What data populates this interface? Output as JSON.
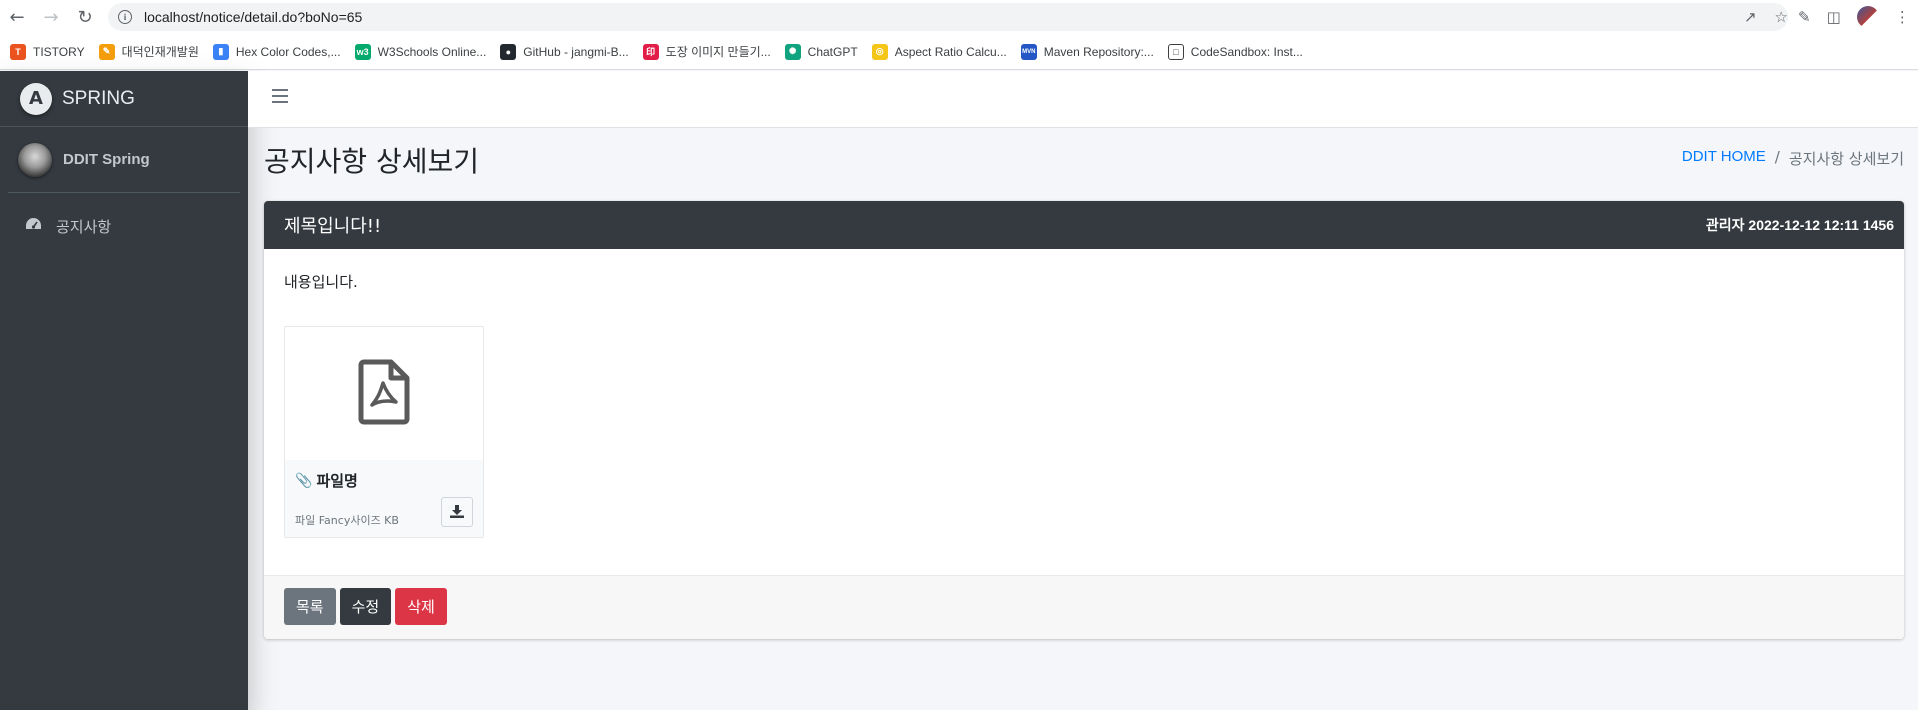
{
  "browser": {
    "url": "localhost/notice/detail.do?boNo=65",
    "bookmarks": [
      {
        "label": "TISTORY",
        "color": "#eb531f",
        "icon": "T"
      },
      {
        "label": "대덕인재개발원",
        "color": "#f59e0b",
        "icon": "✎"
      },
      {
        "label": "Hex Color Codes,...",
        "color": "#3b82f6",
        "icon": "▮"
      },
      {
        "label": "W3Schools Online...",
        "color": "#04aa6d",
        "icon": "w3"
      },
      {
        "label": "GitHub - jangmi-B...",
        "color": "#24292f",
        "icon": "●"
      },
      {
        "label": "도장 이미지 만들기...",
        "color": "#e11d48",
        "icon": "印"
      },
      {
        "label": "ChatGPT",
        "color": "#10a37f",
        "icon": "✺"
      },
      {
        "label": "Aspect Ratio Calcu...",
        "color": "#f5c518",
        "icon": "◎"
      },
      {
        "label": "Maven Repository:...",
        "color": "#2457c5",
        "icon": "MVN"
      },
      {
        "label": "CodeSandbox: Inst...",
        "color": "#ffffff",
        "icon": "□"
      }
    ]
  },
  "sidebar": {
    "brand": "SPRING",
    "brand_logo": "A",
    "user": "DDIT Spring",
    "items": [
      {
        "label": "공지사항",
        "icon": "tachometer-icon"
      }
    ]
  },
  "page": {
    "title": "공지사항 상세보기",
    "breadcrumb": {
      "home": "DDIT HOME",
      "current": "공지사항 상세보기"
    }
  },
  "notice": {
    "title": "제목입니다!!",
    "meta": "관리자 2022-12-12 12:11 1456",
    "content": "내용입니다.",
    "attachment": {
      "name": "파일명",
      "size": "파일 Fancy사이즈 KB",
      "type": "pdf"
    }
  },
  "actions": {
    "list": "목록",
    "edit": "수정",
    "delete": "삭제"
  },
  "colors": {
    "sidebar": "#343a40",
    "link": "#007bff",
    "danger": "#dc3545",
    "secondary": "#6c757d"
  }
}
